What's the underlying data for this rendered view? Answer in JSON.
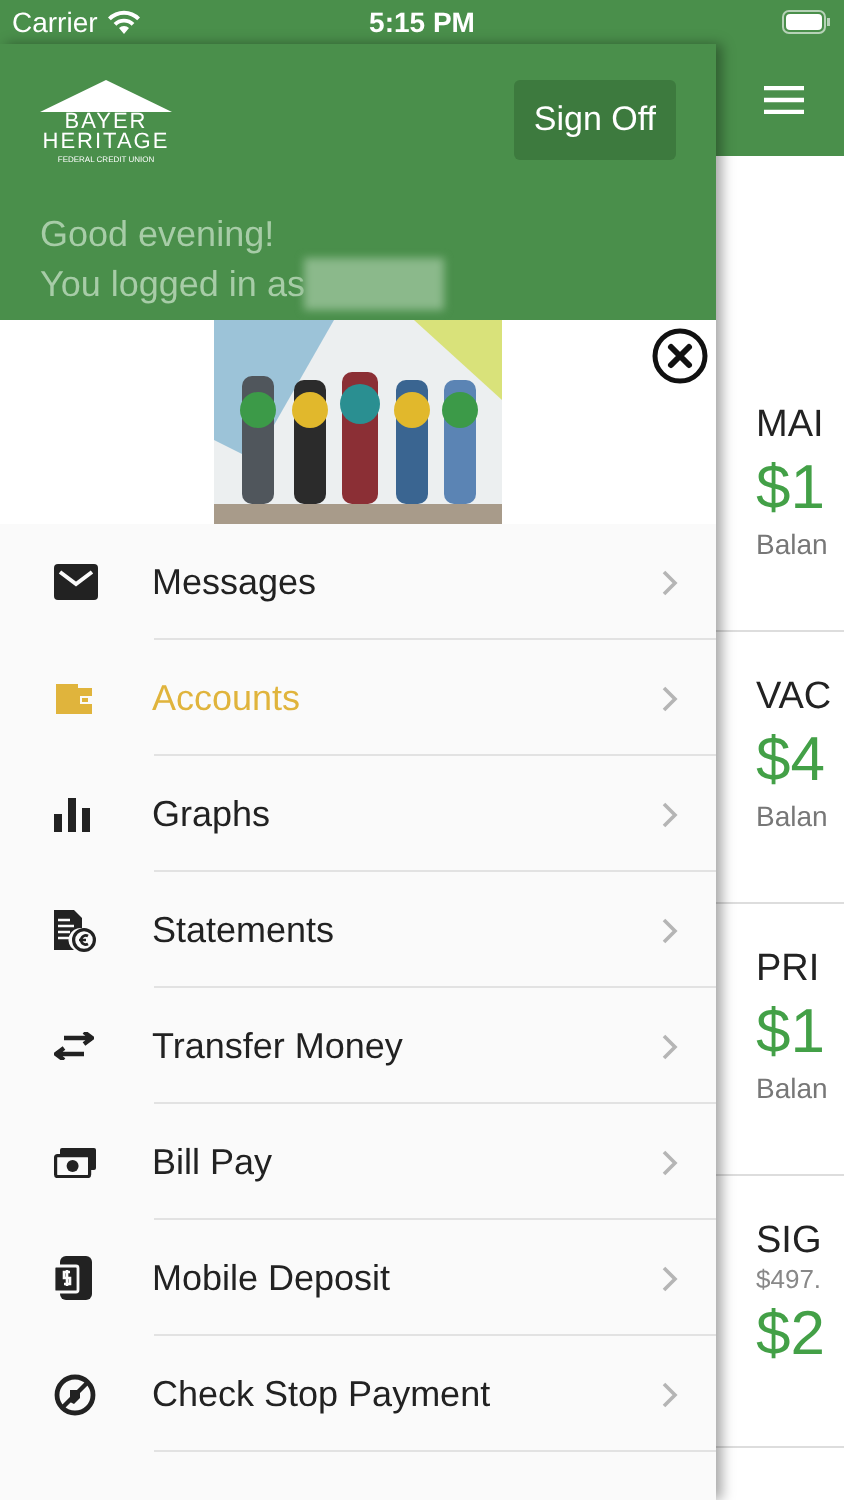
{
  "status_bar": {
    "carrier": "Carrier",
    "time": "5:15 PM"
  },
  "drawer": {
    "logo": {
      "line_1": "BAYER",
      "line_2": "HERITAGE",
      "line_3": "FEDERAL CREDIT UNION"
    },
    "sign_off": "Sign Off",
    "greeting": "Good evening!",
    "logged_in": "You logged in as",
    "menu": [
      {
        "label": "Messages",
        "selected": false
      },
      {
        "label": "Accounts",
        "selected": true
      },
      {
        "label": "Graphs",
        "selected": false
      },
      {
        "label": "Statements",
        "selected": false
      },
      {
        "label": "Transfer Money",
        "selected": false
      },
      {
        "label": "Bill Pay",
        "selected": false
      },
      {
        "label": "Mobile Deposit",
        "selected": false
      },
      {
        "label": "Check Stop Payment",
        "selected": false
      }
    ]
  },
  "accounts": [
    {
      "name": "MAI",
      "balance": "$1",
      "note": "Balan"
    },
    {
      "name": "VAC",
      "balance": "$4",
      "note": "Balan"
    },
    {
      "name": "PRI",
      "balance": "$1",
      "note": "Balan"
    },
    {
      "name": "SIG",
      "sub": "$497.",
      "balance": "$2"
    }
  ]
}
